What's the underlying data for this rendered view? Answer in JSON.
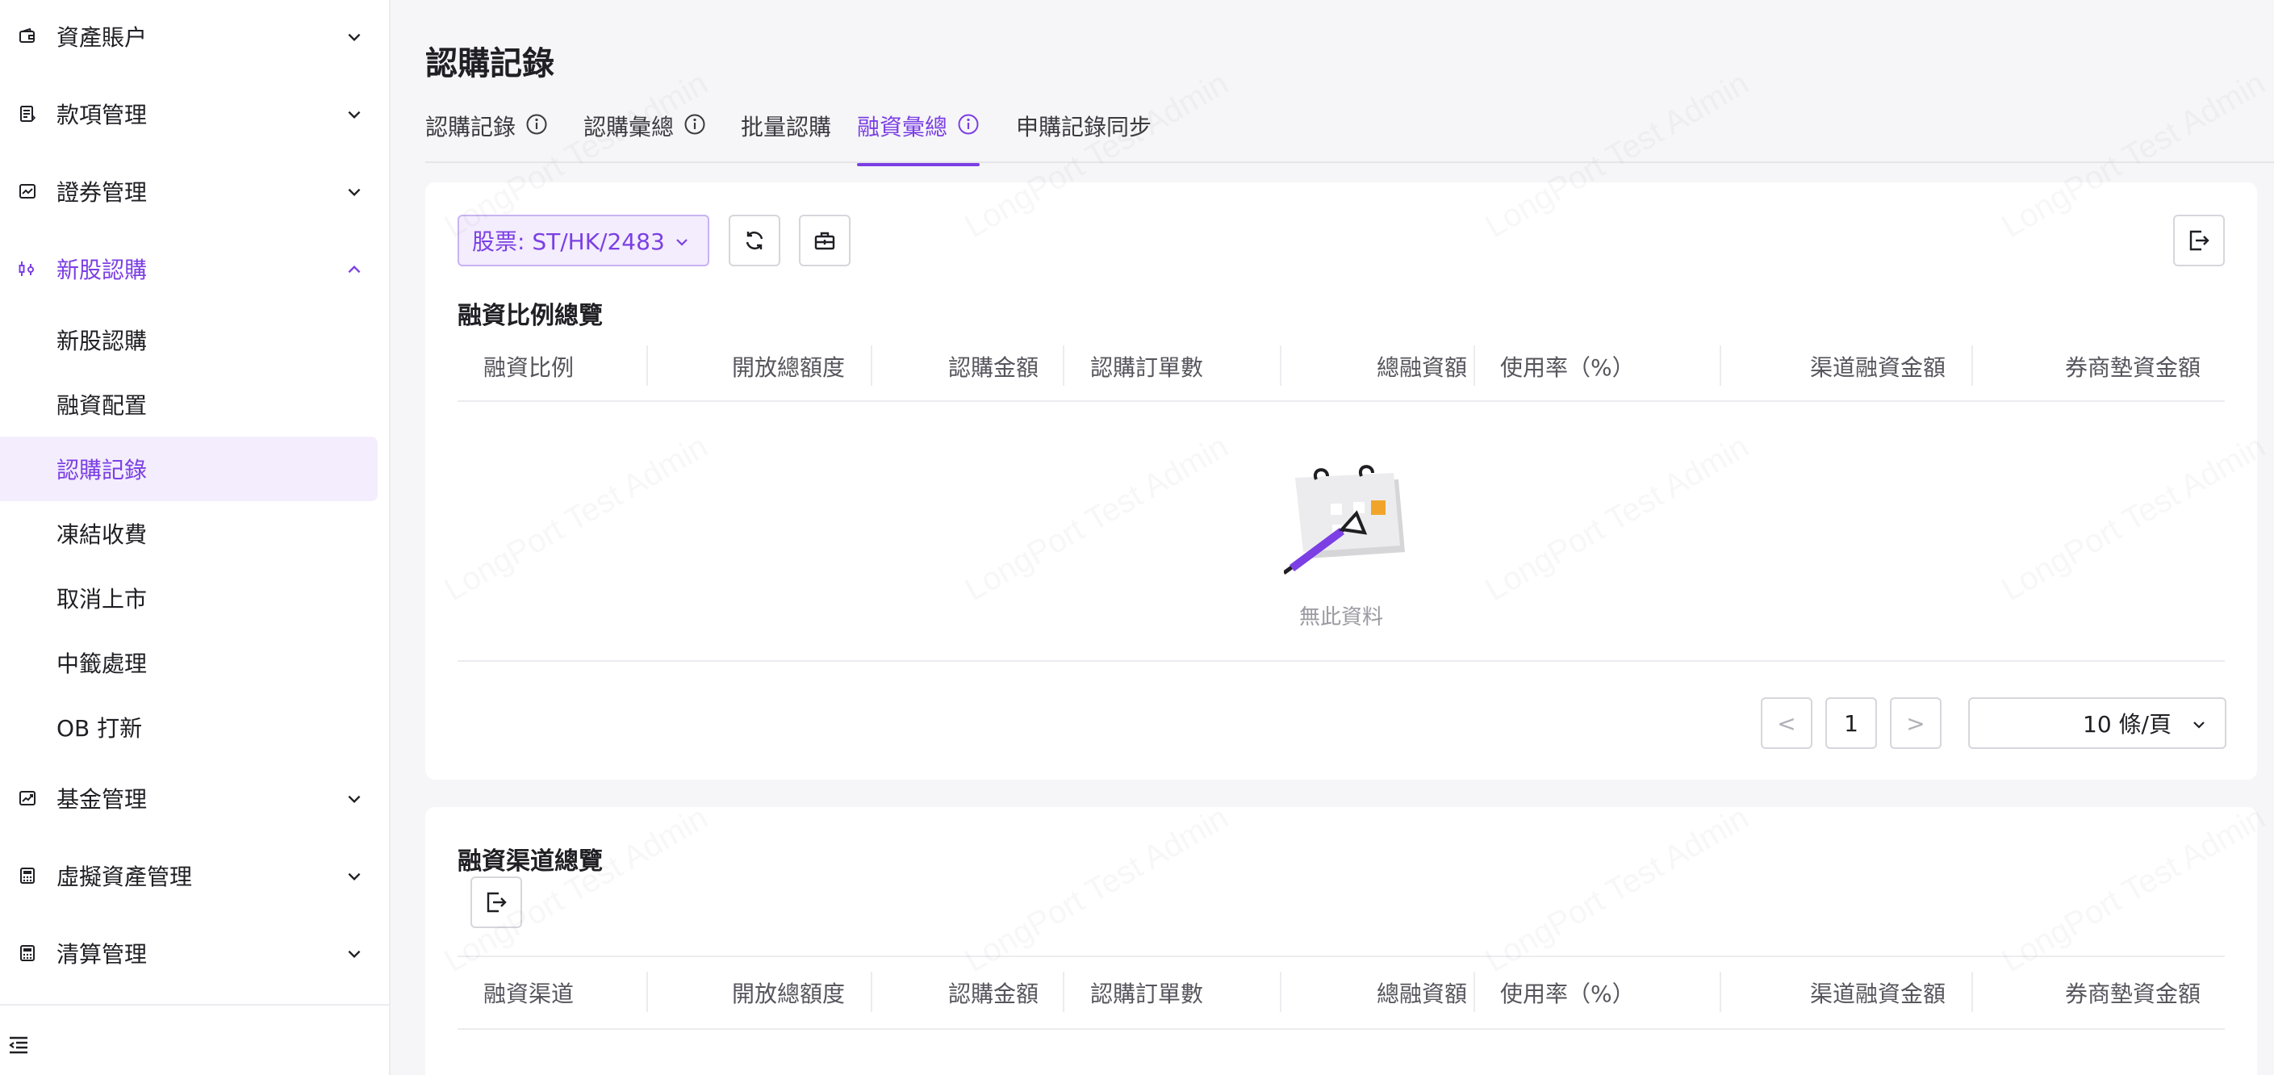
{
  "sidebar": {
    "groups": [
      {
        "label": "資產賬户",
        "icon": "wallet-icon"
      },
      {
        "label": "款項管理",
        "icon": "ledger-icon"
      },
      {
        "label": "證券管理",
        "icon": "securities-icon"
      },
      {
        "label": "新股認購",
        "icon": "ipo-icon"
      },
      {
        "label": "基金管理",
        "icon": "fund-chart-icon"
      },
      {
        "label": "虛擬資產管理",
        "icon": "calculator-icon"
      },
      {
        "label": "清算管理",
        "icon": "calculator-icon"
      }
    ],
    "sub_items": [
      {
        "label": "新股認購"
      },
      {
        "label": "融資配置"
      },
      {
        "label": "認購記錄"
      },
      {
        "label": "凍結收費"
      },
      {
        "label": "取消上市"
      },
      {
        "label": "中籤處理"
      },
      {
        "label": "OB 打新"
      }
    ]
  },
  "page": {
    "title": "認購記錄"
  },
  "tabs": [
    {
      "label": "認購記錄"
    },
    {
      "label": "認購彙總"
    },
    {
      "label": "批量認購"
    },
    {
      "label": "融資彙總"
    },
    {
      "label": "申購記錄同步"
    }
  ],
  "filter": {
    "stock_label": "股票: ST/HK/2483"
  },
  "section1": {
    "title": "融資比例總覽",
    "columns": [
      "融資比例",
      "開放總額度",
      "認購金額",
      "認購訂單數",
      "總融資額",
      "使用率（%）",
      "渠道融資金額",
      "券商墊資金額"
    ],
    "empty_text": "無此資料"
  },
  "pagination": {
    "current_page": "1",
    "page_size": "10 條/頁",
    "prev": "<",
    "next": ">"
  },
  "section2": {
    "title": "融資渠道總覽",
    "columns": [
      "融資渠道",
      "開放總額度",
      "認購金額",
      "認購訂單數",
      "總融資額",
      "使用率（%）",
      "渠道融資金額",
      "券商墊資金額"
    ]
  },
  "watermark": "LongPort Test Admin",
  "colors": {
    "accent": "#7b3fe4",
    "accent_bg": "#f3edfd",
    "page_bg": "#f6f6f8"
  }
}
